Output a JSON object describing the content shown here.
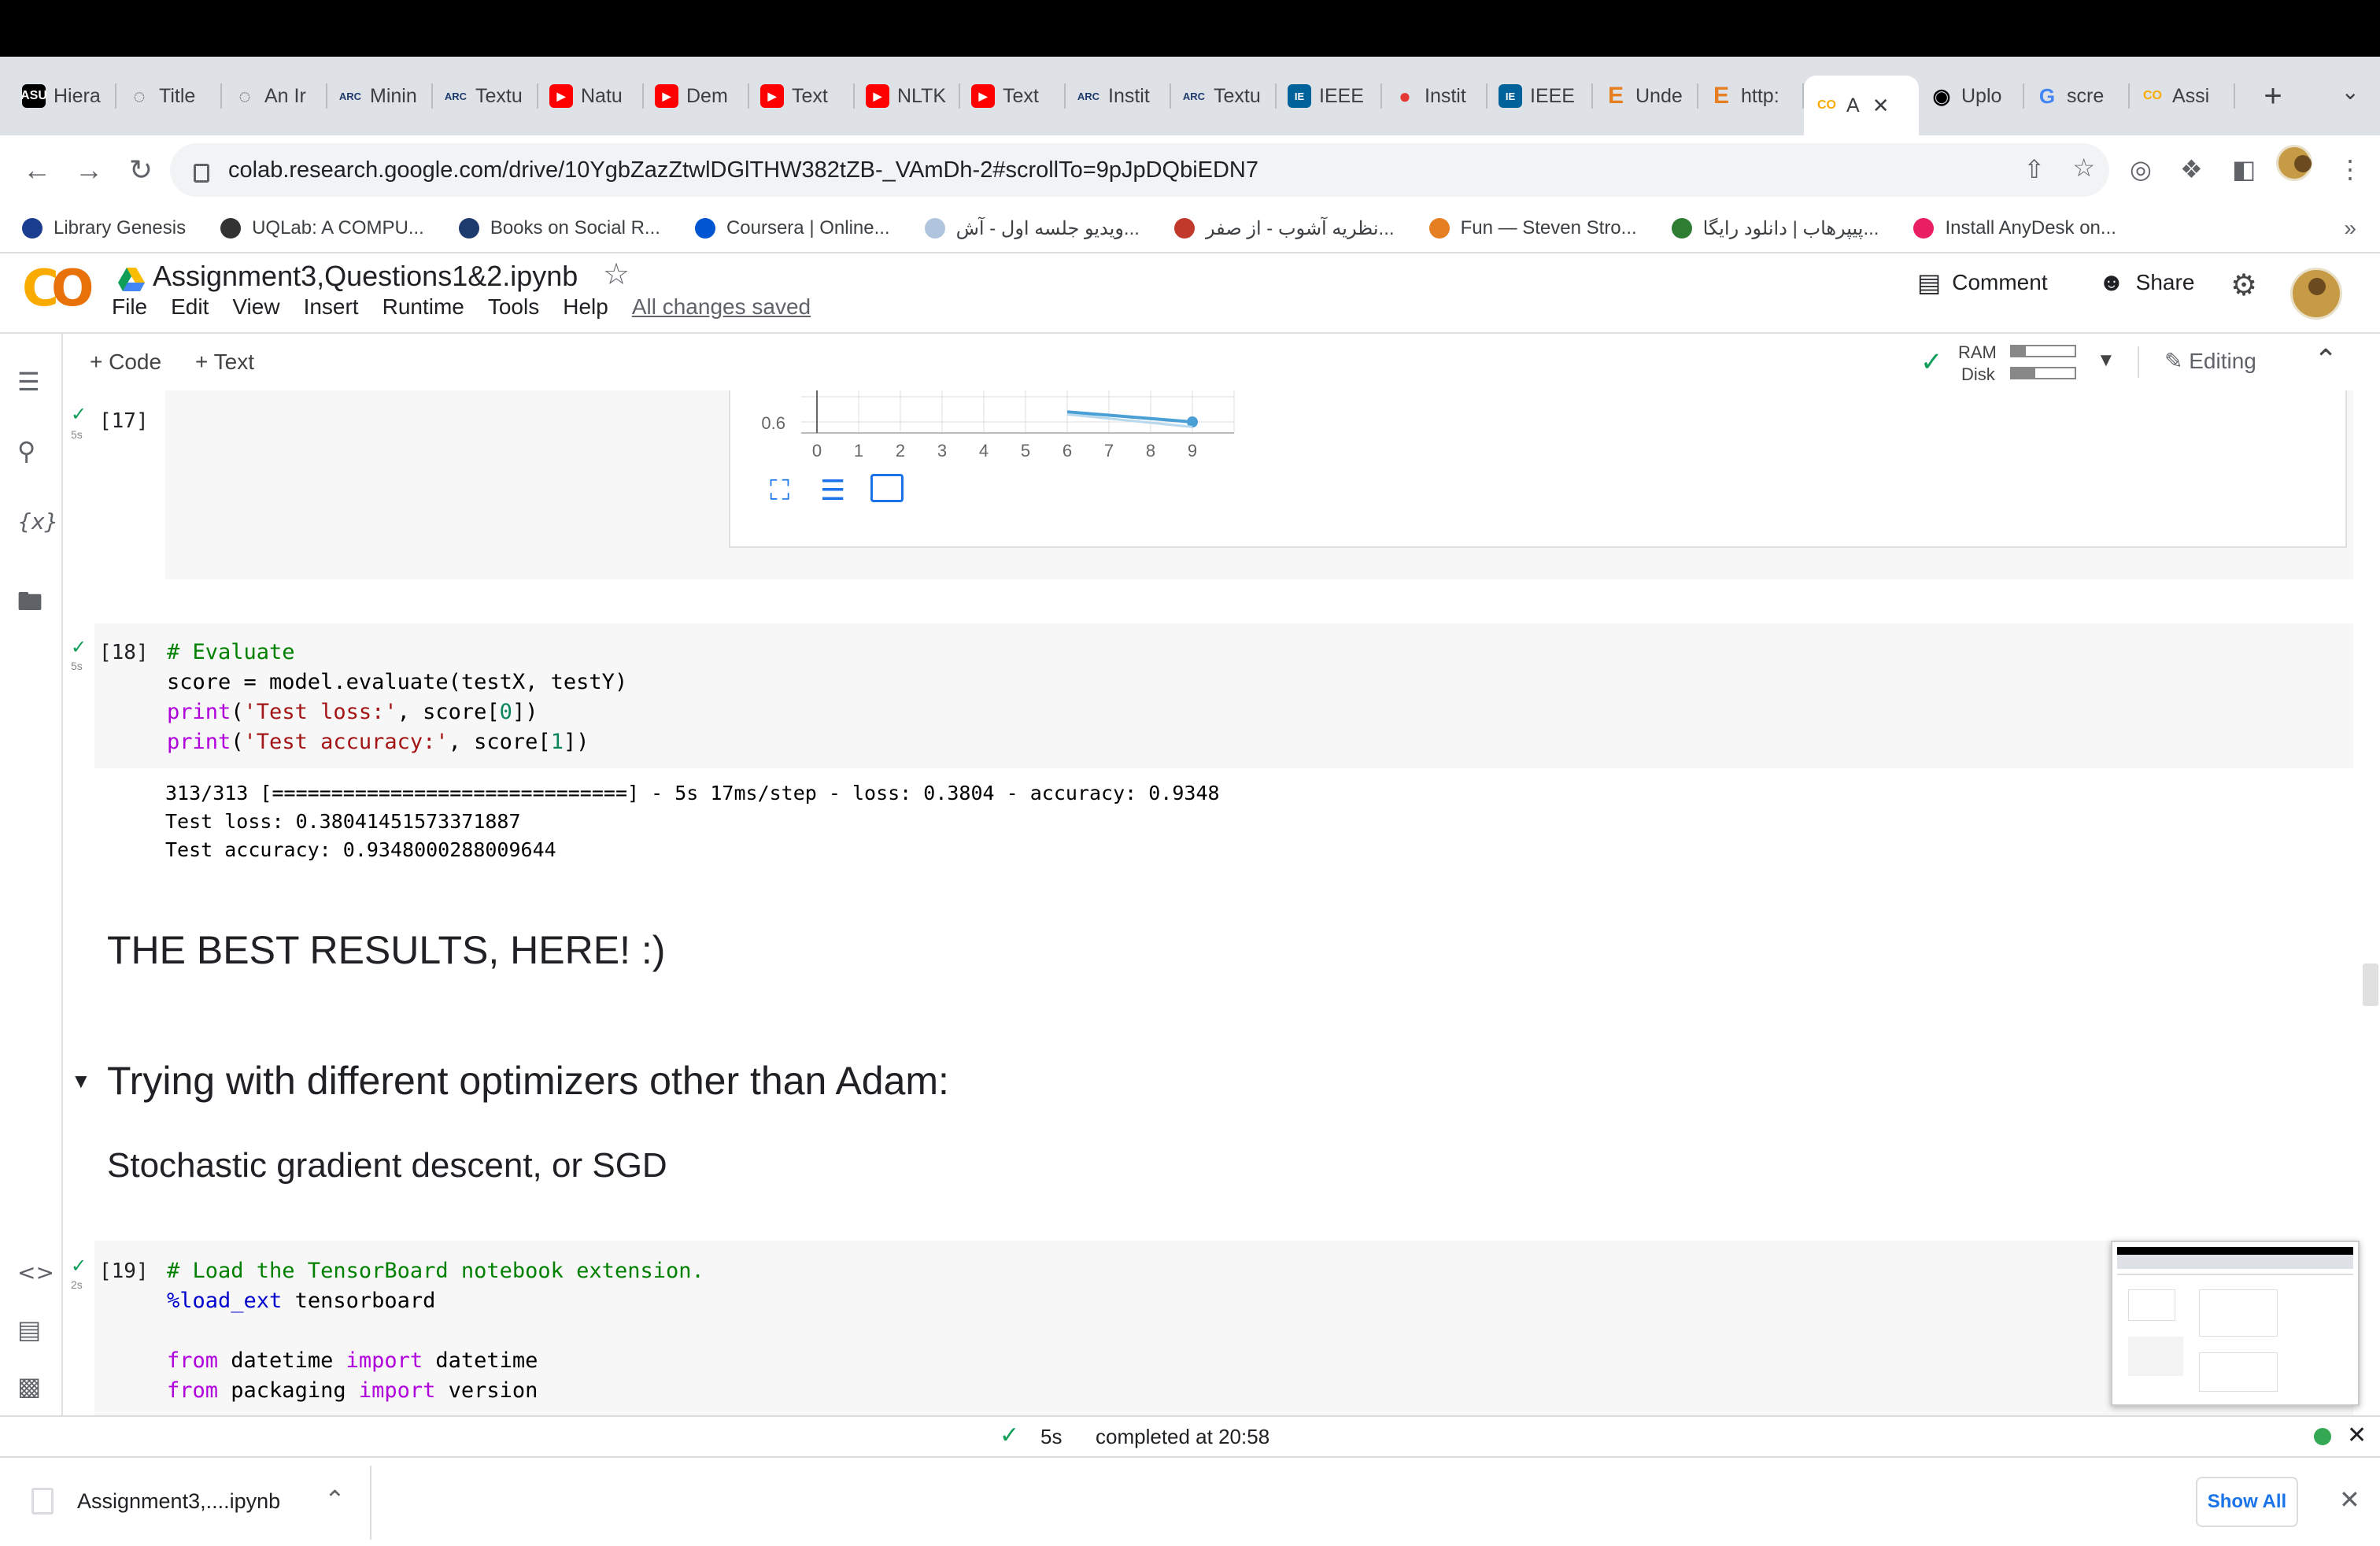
{
  "browser": {
    "tabs": [
      {
        "icon": "asu-icon",
        "label": "Hiera"
      },
      {
        "icon": "globe-icon",
        "label": "Title"
      },
      {
        "icon": "globe-icon",
        "label": "An Ir"
      },
      {
        "icon": "arc-icon",
        "label": "Minin"
      },
      {
        "icon": "arc-icon",
        "label": "Textu"
      },
      {
        "icon": "youtube-icon",
        "label": "Natu"
      },
      {
        "icon": "youtube-icon",
        "label": "Dem"
      },
      {
        "icon": "youtube-icon",
        "label": "Text"
      },
      {
        "icon": "youtube-icon",
        "label": "NLTK"
      },
      {
        "icon": "youtube-icon",
        "label": "Text"
      },
      {
        "icon": "arc-icon",
        "label": "Instit"
      },
      {
        "icon": "arc-icon",
        "label": "Textu"
      },
      {
        "icon": "ieee-icon",
        "label": "IEEE"
      },
      {
        "icon": "multicolor-icon",
        "label": "Instit"
      },
      {
        "icon": "ieee-icon",
        "label": "IEEE"
      },
      {
        "icon": "elsevier-icon",
        "label": "Unde"
      },
      {
        "icon": "elsevier-icon",
        "label": "http:"
      },
      {
        "icon": "colab-icon",
        "label": "A",
        "active": true
      },
      {
        "icon": "github-icon",
        "label": "Uplo"
      },
      {
        "icon": "google-icon",
        "label": "scre"
      },
      {
        "icon": "colab-icon",
        "label": "Assi"
      }
    ],
    "url": "colab.research.google.com/drive/10YgbZazZtwlDGlTHW382tZB-_VAmDh-2#scrollTo=9pJpDQbiEDN7",
    "bookmarks": [
      {
        "label": "Library Genesis",
        "color": "#1a3d8f"
      },
      {
        "label": "UQLab: A COMPU...",
        "color": "#333333"
      },
      {
        "label": "Books on Social R...",
        "color": "#1e3b6d"
      },
      {
        "label": "Coursera | Online...",
        "color": "#0056d2"
      },
      {
        "label": "ویدیو جلسه اول - آش...",
        "color": "#b0c4de"
      },
      {
        "label": "نظریه آشوب - از صفر...",
        "color": "#c0392b"
      },
      {
        "label": "Fun — Steven Stro...",
        "color": "#e67e22"
      },
      {
        "label": "پیپرهاب | دانلود رایگا...",
        "color": "#2e7d32"
      },
      {
        "label": "Install AnyDesk on...",
        "color": "#e91e63"
      }
    ]
  },
  "colab": {
    "title": "Assignment3,Questions1&2.ipynb",
    "menu": [
      "File",
      "Edit",
      "View",
      "Insert",
      "Runtime",
      "Tools",
      "Help"
    ],
    "saved_status": "All changes saved",
    "comment_label": "Comment",
    "share_label": "Share",
    "add_code_label": "+ Code",
    "add_text_label": "+ Text",
    "ram_label": "RAM",
    "disk_label": "Disk",
    "ram_usage": 0.22,
    "disk_usage": 0.38,
    "editing_label": "Editing"
  },
  "cells": {
    "c17": {
      "exec": "[17]",
      "time": "5s"
    },
    "c18": {
      "exec": "[18]",
      "time": "5s",
      "out1": "313/313 [==============================] - 5s 17ms/step - loss: 0.3804 - accuracy: 0.9348",
      "out2": "Test loss: 0.38041451573371887",
      "out3": "Test accuracy: 0.9348000288009644"
    },
    "best_results": "THE BEST RESULTS, HERE! :)",
    "section_heading": "Trying with different optimizers other than Adam:",
    "subheading": "Stochastic gradient descent, or SGD",
    "c19": {
      "exec": "[19]",
      "time": "2s"
    }
  },
  "chart_data": {
    "type": "line",
    "x_ticks": [
      "0",
      "1",
      "2",
      "3",
      "4",
      "5",
      "6",
      "7",
      "8",
      "9"
    ],
    "y_tick_visible": "0.6",
    "series": [
      {
        "values_visible": [
          [
            6,
            0.64
          ],
          [
            9,
            0.6
          ]
        ],
        "color": "#4a9fd5"
      },
      {
        "values_visible": [
          [
            6,
            0.63
          ],
          [
            9,
            0.58
          ]
        ],
        "color": "#b8d8ee"
      }
    ]
  },
  "status": {
    "time": "5s",
    "text": "completed at 20:58"
  },
  "downloads": {
    "file": "Assignment3,....ipynb",
    "show_all": "Show All"
  }
}
